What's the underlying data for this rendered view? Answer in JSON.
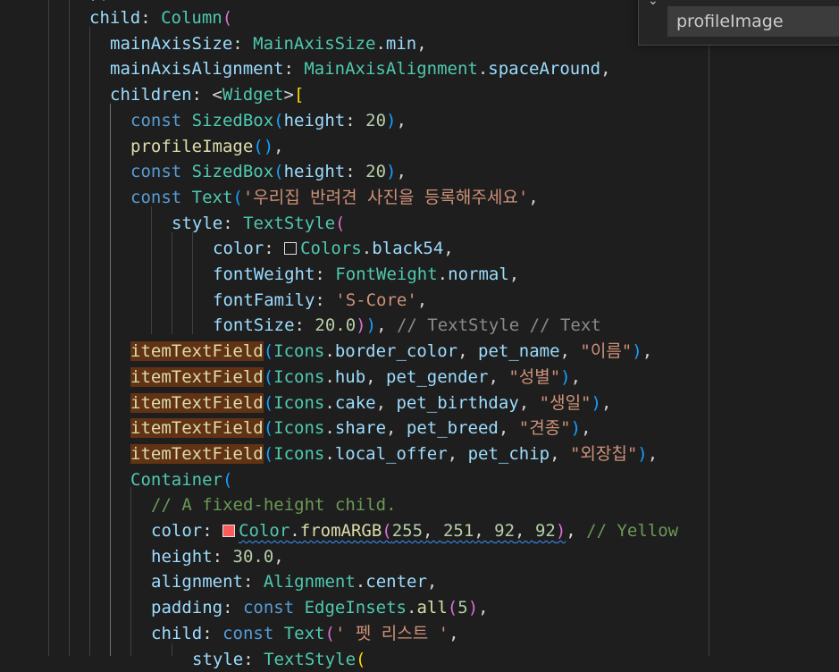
{
  "colors": {
    "background": "#1e1e1e",
    "keyword": "#569cd6",
    "type": "#4ec9b0",
    "property": "#9cdcfe",
    "function": "#dcdcaa",
    "string": "#ce9178",
    "number": "#b5cea8",
    "comment": "#6a9955",
    "match_highlight": "#613214",
    "swatch_black54": "#1e1e1e",
    "swatch_red": "#fb5c5c"
  },
  "find_widget": {
    "toggle_icon": "chevron-down-icon",
    "query": "profileImage"
  },
  "code_lines": [
    {
      "indent": 0,
      "tokens": [
        {
          "t": "child",
          "c": "prop"
        },
        {
          "t": ": ",
          "c": "plain"
        },
        {
          "t": "Column",
          "c": "type"
        },
        {
          "t": "(",
          "c": "bracket1"
        }
      ]
    },
    {
      "indent": 1,
      "tokens": [
        {
          "t": "mainAxisSize",
          "c": "prop"
        },
        {
          "t": ": ",
          "c": "plain"
        },
        {
          "t": "MainAxisSize",
          "c": "type"
        },
        {
          "t": ".",
          "c": "plain"
        },
        {
          "t": "min",
          "c": "prop"
        },
        {
          "t": ",",
          "c": "plain"
        }
      ]
    },
    {
      "indent": 1,
      "tokens": [
        {
          "t": "mainAxisAlignment",
          "c": "prop"
        },
        {
          "t": ": ",
          "c": "plain"
        },
        {
          "t": "MainAxisAlignment",
          "c": "type"
        },
        {
          "t": ".",
          "c": "plain"
        },
        {
          "t": "spaceAround",
          "c": "prop"
        },
        {
          "t": ",",
          "c": "plain"
        }
      ]
    },
    {
      "indent": 1,
      "tokens": [
        {
          "t": "children",
          "c": "prop"
        },
        {
          "t": ": <",
          "c": "plain"
        },
        {
          "t": "Widget",
          "c": "type"
        },
        {
          "t": ">",
          "c": "plain"
        },
        {
          "t": "[",
          "c": "bracket2"
        }
      ]
    },
    {
      "indent": 2,
      "tokens": [
        {
          "t": "const ",
          "c": "kw"
        },
        {
          "t": "SizedBox",
          "c": "type"
        },
        {
          "t": "(",
          "c": "bracket3"
        },
        {
          "t": "height",
          "c": "prop"
        },
        {
          "t": ": ",
          "c": "plain"
        },
        {
          "t": "20",
          "c": "num"
        },
        {
          "t": ")",
          "c": "bracket3"
        },
        {
          "t": ",",
          "c": "plain"
        }
      ]
    },
    {
      "indent": 2,
      "tokens": [
        {
          "t": "profileImage",
          "c": "func"
        },
        {
          "t": "()",
          "c": "bracket3"
        },
        {
          "t": ",",
          "c": "plain"
        }
      ]
    },
    {
      "indent": 2,
      "tokens": [
        {
          "t": "const ",
          "c": "kw"
        },
        {
          "t": "SizedBox",
          "c": "type"
        },
        {
          "t": "(",
          "c": "bracket3"
        },
        {
          "t": "height",
          "c": "prop"
        },
        {
          "t": ": ",
          "c": "plain"
        },
        {
          "t": "20",
          "c": "num"
        },
        {
          "t": ")",
          "c": "bracket3"
        },
        {
          "t": ",",
          "c": "plain"
        }
      ]
    },
    {
      "indent": 2,
      "tokens": [
        {
          "t": "const ",
          "c": "kw"
        },
        {
          "t": "Text",
          "c": "type"
        },
        {
          "t": "(",
          "c": "bracket3"
        },
        {
          "t": "'우리집 반려견 사진을 등록해주세요'",
          "c": "str"
        },
        {
          "t": ",",
          "c": "plain"
        }
      ]
    },
    {
      "indent": 4,
      "tokens": [
        {
          "t": "style",
          "c": "prop"
        },
        {
          "t": ": ",
          "c": "plain"
        },
        {
          "t": "TextStyle",
          "c": "type"
        },
        {
          "t": "(",
          "c": "bracket1"
        }
      ]
    },
    {
      "indent": 6,
      "tokens": [
        {
          "t": "color",
          "c": "prop"
        },
        {
          "t": ": ",
          "c": "plain"
        },
        {
          "t": "",
          "c": "swatch",
          "swatch": "black54"
        },
        {
          "t": "Colors",
          "c": "type"
        },
        {
          "t": ".",
          "c": "plain"
        },
        {
          "t": "black54",
          "c": "prop"
        },
        {
          "t": ",",
          "c": "plain"
        }
      ]
    },
    {
      "indent": 6,
      "tokens": [
        {
          "t": "fontWeight",
          "c": "prop"
        },
        {
          "t": ": ",
          "c": "plain"
        },
        {
          "t": "FontWeight",
          "c": "type"
        },
        {
          "t": ".",
          "c": "plain"
        },
        {
          "t": "normal",
          "c": "prop"
        },
        {
          "t": ",",
          "c": "plain"
        }
      ]
    },
    {
      "indent": 6,
      "tokens": [
        {
          "t": "fontFamily",
          "c": "prop"
        },
        {
          "t": ": ",
          "c": "plain"
        },
        {
          "t": "'S-Core'",
          "c": "str"
        },
        {
          "t": ",",
          "c": "plain"
        }
      ]
    },
    {
      "indent": 6,
      "tokens": [
        {
          "t": "fontSize",
          "c": "prop"
        },
        {
          "t": ": ",
          "c": "plain"
        },
        {
          "t": "20.0",
          "c": "num"
        },
        {
          "t": ")",
          "c": "bracket1"
        },
        {
          "t": ")",
          "c": "bracket3"
        },
        {
          "t": ", ",
          "c": "plain"
        },
        {
          "t": "// TextStyle // Text",
          "c": "gray"
        }
      ]
    },
    {
      "indent": 2,
      "tokens": [
        {
          "t": "itemTextField",
          "c": "func",
          "hl": true
        },
        {
          "t": "(",
          "c": "bracket3"
        },
        {
          "t": "Icons",
          "c": "type"
        },
        {
          "t": ".",
          "c": "plain"
        },
        {
          "t": "border_color",
          "c": "prop"
        },
        {
          "t": ", ",
          "c": "plain"
        },
        {
          "t": "pet_name",
          "c": "prop"
        },
        {
          "t": ", ",
          "c": "plain"
        },
        {
          "t": "\"이름\"",
          "c": "str"
        },
        {
          "t": ")",
          "c": "bracket3"
        },
        {
          "t": ",",
          "c": "plain"
        }
      ]
    },
    {
      "indent": 2,
      "tokens": [
        {
          "t": "itemTextField",
          "c": "func",
          "hl": true
        },
        {
          "t": "(",
          "c": "bracket3"
        },
        {
          "t": "Icons",
          "c": "type"
        },
        {
          "t": ".",
          "c": "plain"
        },
        {
          "t": "hub",
          "c": "prop"
        },
        {
          "t": ", ",
          "c": "plain"
        },
        {
          "t": "pet_gender",
          "c": "prop"
        },
        {
          "t": ", ",
          "c": "plain"
        },
        {
          "t": "\"성별\"",
          "c": "str"
        },
        {
          "t": ")",
          "c": "bracket3"
        },
        {
          "t": ",",
          "c": "plain"
        }
      ]
    },
    {
      "indent": 2,
      "tokens": [
        {
          "t": "itemTextField",
          "c": "func",
          "hl": true
        },
        {
          "t": "(",
          "c": "bracket3"
        },
        {
          "t": "Icons",
          "c": "type"
        },
        {
          "t": ".",
          "c": "plain"
        },
        {
          "t": "cake",
          "c": "prop"
        },
        {
          "t": ", ",
          "c": "plain"
        },
        {
          "t": "pet_birthday",
          "c": "prop"
        },
        {
          "t": ", ",
          "c": "plain"
        },
        {
          "t": "\"생일\"",
          "c": "str"
        },
        {
          "t": ")",
          "c": "bracket3"
        },
        {
          "t": ",",
          "c": "plain"
        }
      ]
    },
    {
      "indent": 2,
      "tokens": [
        {
          "t": "itemTextField",
          "c": "func",
          "hl": true
        },
        {
          "t": "(",
          "c": "bracket3"
        },
        {
          "t": "Icons",
          "c": "type"
        },
        {
          "t": ".",
          "c": "plain"
        },
        {
          "t": "share",
          "c": "prop"
        },
        {
          "t": ", ",
          "c": "plain"
        },
        {
          "t": "pet_breed",
          "c": "prop"
        },
        {
          "t": ", ",
          "c": "plain"
        },
        {
          "t": "\"견종\"",
          "c": "str"
        },
        {
          "t": ")",
          "c": "bracket3"
        },
        {
          "t": ",",
          "c": "plain"
        }
      ]
    },
    {
      "indent": 2,
      "tokens": [
        {
          "t": "itemTextField",
          "c": "func",
          "hl": true
        },
        {
          "t": "(",
          "c": "bracket3"
        },
        {
          "t": "Icons",
          "c": "type"
        },
        {
          "t": ".",
          "c": "plain"
        },
        {
          "t": "local_offer",
          "c": "prop"
        },
        {
          "t": ", ",
          "c": "plain"
        },
        {
          "t": "pet_chip",
          "c": "prop"
        },
        {
          "t": ", ",
          "c": "plain"
        },
        {
          "t": "\"외장칩\"",
          "c": "str"
        },
        {
          "t": ")",
          "c": "bracket3"
        },
        {
          "t": ",",
          "c": "plain"
        }
      ]
    },
    {
      "indent": 2,
      "tokens": [
        {
          "t": "Container",
          "c": "type"
        },
        {
          "t": "(",
          "c": "bracket3"
        }
      ]
    },
    {
      "indent": 3,
      "tokens": [
        {
          "t": "// A fixed-height child.",
          "c": "comment"
        }
      ]
    },
    {
      "indent": 3,
      "tokens": [
        {
          "t": "color",
          "c": "prop"
        },
        {
          "t": ": ",
          "c": "plain"
        },
        {
          "t": "",
          "c": "swatch",
          "swatch": "red"
        },
        {
          "t": "Color",
          "c": "type",
          "sq": true
        },
        {
          "t": ".",
          "c": "plain",
          "sq": true
        },
        {
          "t": "fromARGB",
          "c": "func",
          "sq": true
        },
        {
          "t": "(",
          "c": "bracket1",
          "sq": true
        },
        {
          "t": "255",
          "c": "num",
          "sq": true
        },
        {
          "t": ", ",
          "c": "plain",
          "sq": true
        },
        {
          "t": "251",
          "c": "num",
          "sq": true
        },
        {
          "t": ", ",
          "c": "plain",
          "sq": true
        },
        {
          "t": "92",
          "c": "num",
          "sq": true
        },
        {
          "t": ", ",
          "c": "plain",
          "sq": true
        },
        {
          "t": "92",
          "c": "num",
          "sq": true
        },
        {
          "t": ")",
          "c": "bracket1",
          "sq": true
        },
        {
          "t": ", ",
          "c": "plain"
        },
        {
          "t": "// Yellow",
          "c": "comment"
        }
      ]
    },
    {
      "indent": 3,
      "tokens": [
        {
          "t": "height",
          "c": "prop"
        },
        {
          "t": ": ",
          "c": "plain"
        },
        {
          "t": "30.0",
          "c": "num"
        },
        {
          "t": ",",
          "c": "plain"
        }
      ]
    },
    {
      "indent": 3,
      "tokens": [
        {
          "t": "alignment",
          "c": "prop"
        },
        {
          "t": ": ",
          "c": "plain"
        },
        {
          "t": "Alignment",
          "c": "type"
        },
        {
          "t": ".",
          "c": "plain"
        },
        {
          "t": "center",
          "c": "prop"
        },
        {
          "t": ",",
          "c": "plain"
        }
      ]
    },
    {
      "indent": 3,
      "tokens": [
        {
          "t": "padding",
          "c": "prop"
        },
        {
          "t": ": ",
          "c": "plain"
        },
        {
          "t": "const ",
          "c": "kw"
        },
        {
          "t": "EdgeInsets",
          "c": "type"
        },
        {
          "t": ".",
          "c": "plain"
        },
        {
          "t": "all",
          "c": "func"
        },
        {
          "t": "(",
          "c": "bracket1"
        },
        {
          "t": "5",
          "c": "num"
        },
        {
          "t": ")",
          "c": "bracket1"
        },
        {
          "t": ",",
          "c": "plain"
        }
      ]
    },
    {
      "indent": 3,
      "tokens": [
        {
          "t": "child",
          "c": "prop"
        },
        {
          "t": ": ",
          "c": "plain"
        },
        {
          "t": "const ",
          "c": "kw"
        },
        {
          "t": "Text",
          "c": "type"
        },
        {
          "t": "(",
          "c": "bracket1"
        },
        {
          "t": "' 펫 리스트 '",
          "c": "str"
        },
        {
          "t": ",",
          "c": "plain"
        }
      ]
    },
    {
      "indent": 5,
      "tokens": [
        {
          "t": "style",
          "c": "prop"
        },
        {
          "t": ": ",
          "c": "plain"
        },
        {
          "t": "TextStyle",
          "c": "type"
        },
        {
          "t": "(",
          "c": "bracket2"
        }
      ]
    }
  ]
}
